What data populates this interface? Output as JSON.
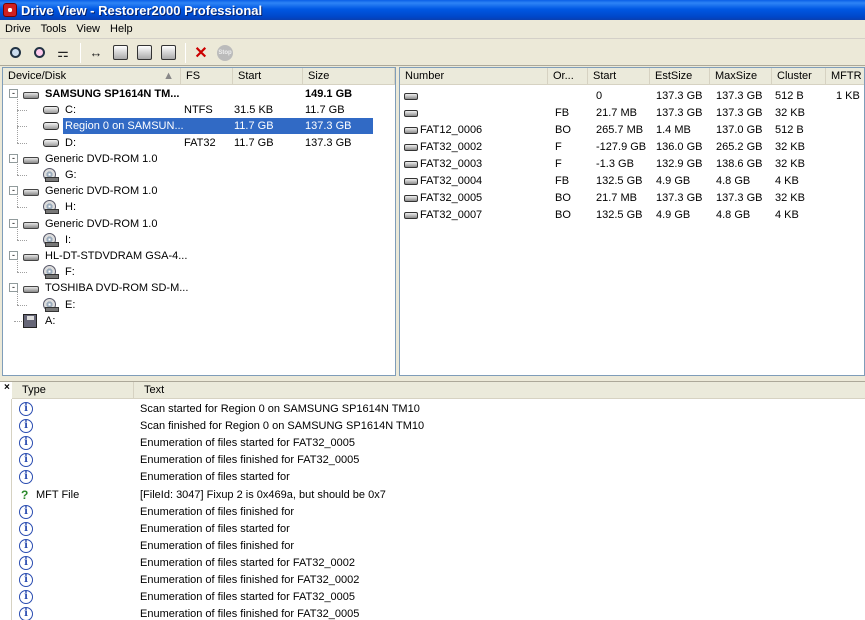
{
  "window": {
    "title": "Drive View - Restorer2000 Professional"
  },
  "menu": [
    "Drive",
    "Tools",
    "View",
    "Help"
  ],
  "toolbar": {
    "icons": [
      "scan-icon",
      "scan-region-icon",
      "find-icon",
      "resize-icon",
      "open-icon",
      "save-icon",
      "files-icon",
      "delete-icon",
      "stop-icon"
    ],
    "stop_label": "Stop"
  },
  "tree": {
    "headers": {
      "device": "Device/Disk",
      "fs": "FS",
      "start": "Start",
      "size": "Size"
    },
    "rows": [
      {
        "label": "SAMSUNG SP1614N TM...",
        "fs": "",
        "start": "",
        "size": "149.1 GB",
        "kind": "hdd",
        "level": 0,
        "bold": true,
        "expander": "-"
      },
      {
        "label": "C:",
        "fs": "NTFS",
        "start": "31.5 KB",
        "size": "11.7 GB",
        "kind": "part",
        "level": 1
      },
      {
        "label": "Region 0 on SAMSUN...",
        "fs": "",
        "start": "11.7 GB",
        "size": "137.3 GB",
        "kind": "part",
        "level": 1,
        "selected": true
      },
      {
        "label": "D:",
        "fs": "FAT32",
        "start": "11.7 GB",
        "size": "137.3 GB",
        "kind": "part",
        "level": 1
      },
      {
        "label": "Generic DVD-ROM 1.0",
        "fs": "",
        "start": "",
        "size": "",
        "kind": "hdd",
        "level": 0,
        "expander": "-"
      },
      {
        "label": "G:",
        "fs": "",
        "start": "",
        "size": "",
        "kind": "cd",
        "level": 1
      },
      {
        "label": "Generic DVD-ROM 1.0",
        "fs": "",
        "start": "",
        "size": "",
        "kind": "hdd",
        "level": 0,
        "expander": "-"
      },
      {
        "label": "H:",
        "fs": "",
        "start": "",
        "size": "",
        "kind": "cd",
        "level": 1
      },
      {
        "label": "Generic DVD-ROM 1.0",
        "fs": "",
        "start": "",
        "size": "",
        "kind": "hdd",
        "level": 0,
        "expander": "-"
      },
      {
        "label": "I:",
        "fs": "",
        "start": "",
        "size": "",
        "kind": "cd",
        "level": 1
      },
      {
        "label": "HL-DT-STDVDRAM GSA-4...",
        "fs": "",
        "start": "",
        "size": "",
        "kind": "hdd",
        "level": 0,
        "expander": "-"
      },
      {
        "label": "F:",
        "fs": "",
        "start": "",
        "size": "",
        "kind": "cd",
        "level": 1
      },
      {
        "label": "TOSHIBA DVD-ROM SD-M...",
        "fs": "",
        "start": "",
        "size": "",
        "kind": "hdd",
        "level": 0,
        "expander": "-"
      },
      {
        "label": "E:",
        "fs": "",
        "start": "",
        "size": "",
        "kind": "cd",
        "level": 1
      },
      {
        "label": "A:",
        "fs": "",
        "start": "",
        "size": "",
        "kind": "floppy",
        "level": 0
      }
    ]
  },
  "regions": {
    "headers": {
      "number": "Number",
      "or": "Or...",
      "start": "Start",
      "estsize": "EstSize",
      "maxsize": "MaxSize",
      "cluster": "Cluster",
      "mftr": "MFTR"
    },
    "rows": [
      {
        "number": "",
        "or": "",
        "start": "0",
        "estsize": "137.3 GB",
        "maxsize": "137.3 GB",
        "cluster": "512 B",
        "mftr": "1 KB"
      },
      {
        "number": "",
        "or": "FB",
        "start": "21.7 MB",
        "estsize": "137.3 GB",
        "maxsize": "137.3 GB",
        "cluster": "32 KB",
        "mftr": ""
      },
      {
        "number": "FAT12_0006",
        "or": "BO",
        "start": "265.7 MB",
        "estsize": "1.4 MB",
        "maxsize": "137.0 GB",
        "cluster": "512 B",
        "mftr": ""
      },
      {
        "number": "FAT32_0002",
        "or": "F",
        "start": "-127.9 GB",
        "estsize": "136.0 GB",
        "maxsize": "265.2 GB",
        "cluster": "32 KB",
        "mftr": ""
      },
      {
        "number": "FAT32_0003",
        "or": "F",
        "start": "-1.3 GB",
        "estsize": "132.9 GB",
        "maxsize": "138.6 GB",
        "cluster": "32 KB",
        "mftr": ""
      },
      {
        "number": "FAT32_0004",
        "or": "FB",
        "start": "132.5 GB",
        "estsize": "4.9 GB",
        "maxsize": "4.8 GB",
        "cluster": "4 KB",
        "mftr": ""
      },
      {
        "number": "FAT32_0005",
        "or": "BO",
        "start": "21.7 MB",
        "estsize": "137.3 GB",
        "maxsize": "137.3 GB",
        "cluster": "32 KB",
        "mftr": ""
      },
      {
        "number": "FAT32_0007",
        "or": "BO",
        "start": "132.5 GB",
        "estsize": "4.9 GB",
        "maxsize": "4.8 GB",
        "cluster": "4 KB",
        "mftr": ""
      }
    ]
  },
  "log": {
    "close_label": "×",
    "headers": {
      "type": "Type",
      "text": "Text"
    },
    "rows": [
      {
        "icon": "info",
        "type": "",
        "text": "Scan started for Region 0 on SAMSUNG SP1614N TM10"
      },
      {
        "icon": "info",
        "type": "",
        "text": "Scan finished for Region 0 on SAMSUNG SP1614N TM10"
      },
      {
        "icon": "info",
        "type": "",
        "text": "Enumeration of files started for FAT32_0005"
      },
      {
        "icon": "info",
        "type": "",
        "text": "Enumeration of files finished for FAT32_0005"
      },
      {
        "icon": "info",
        "type": "",
        "text": "Enumeration of files started for"
      },
      {
        "icon": "question",
        "type": "MFT File",
        "text": "[FileId: 3047] Fixup 2 is 0x469a, but should be 0x7"
      },
      {
        "icon": "info",
        "type": "",
        "text": "Enumeration of files finished for"
      },
      {
        "icon": "info",
        "type": "",
        "text": "Enumeration of files started for"
      },
      {
        "icon": "info",
        "type": "",
        "text": "Enumeration of files finished for"
      },
      {
        "icon": "info",
        "type": "",
        "text": "Enumeration of files started for FAT32_0002"
      },
      {
        "icon": "info",
        "type": "",
        "text": "Enumeration of files finished for FAT32_0002"
      },
      {
        "icon": "info",
        "type": "",
        "text": "Enumeration of files started for FAT32_0005"
      },
      {
        "icon": "info",
        "type": "",
        "text": "Enumeration of files finished for FAT32_0005"
      }
    ]
  }
}
